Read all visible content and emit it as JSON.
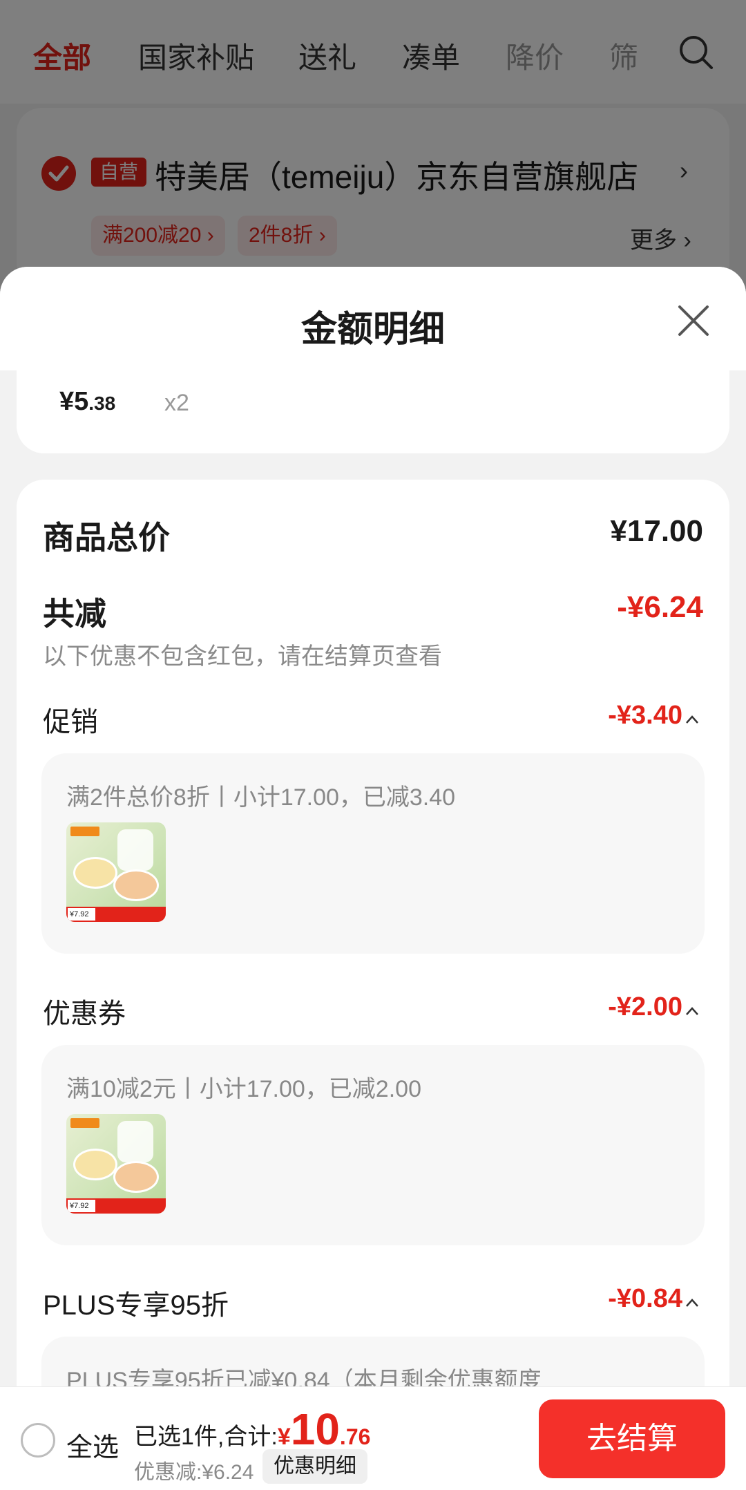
{
  "tabs": [
    {
      "label": "全部"
    },
    {
      "label": "国家补贴"
    },
    {
      "label": "送礼"
    },
    {
      "label": "凑单"
    },
    {
      "label": "降价"
    },
    {
      "label": "筛"
    }
  ],
  "store": {
    "badge": "自营",
    "name": "特美居（temeiju）京东自营旗舰店",
    "arrow": "›",
    "promos": [
      "满200减20 ›",
      "2件8折 ›"
    ],
    "more": "更多 ›"
  },
  "sheet": {
    "title": "金额明细",
    "item": {
      "price_main": "¥5",
      "price_cents": ".38",
      "qty": "x2"
    },
    "total": {
      "label": "商品总价",
      "value": "¥17.00"
    },
    "reduce": {
      "label": "共减",
      "value": "-¥6.24",
      "note": "以下优惠不包含红包，请在结算页查看"
    },
    "sections": [
      {
        "label": "促销",
        "value": "-¥3.40",
        "detail": "满2件总价8折丨小计17.00，已减3.40",
        "thumb_price": "¥7.92"
      },
      {
        "label": "优惠券",
        "value": "-¥2.00",
        "detail": "满10减2元丨小计17.00，已减2.00",
        "thumb_price": "¥7.92"
      },
      {
        "label": "PLUS专享95折",
        "value": "-¥0.84",
        "detail": "PLUS专享95折已减¥0.84（本月剩余优惠额度"
      }
    ]
  },
  "bottom": {
    "select_all": "全选",
    "total_prefix": "已选1件,合计:",
    "total_yen": "¥",
    "total_int": "10",
    "total_dec": ".76",
    "discount": "优惠减:¥6.24",
    "detail_button": "优惠明细",
    "checkout": "去结算"
  },
  "colors": {
    "accent_red": "#e2231a",
    "checkout_red": "#f4302a",
    "overlay": "rgba(0,0,0,0.5)"
  },
  "icons": [
    "search-icon",
    "check-icon",
    "close-icon",
    "chevron-up-icon",
    "product-thumbnail"
  ]
}
